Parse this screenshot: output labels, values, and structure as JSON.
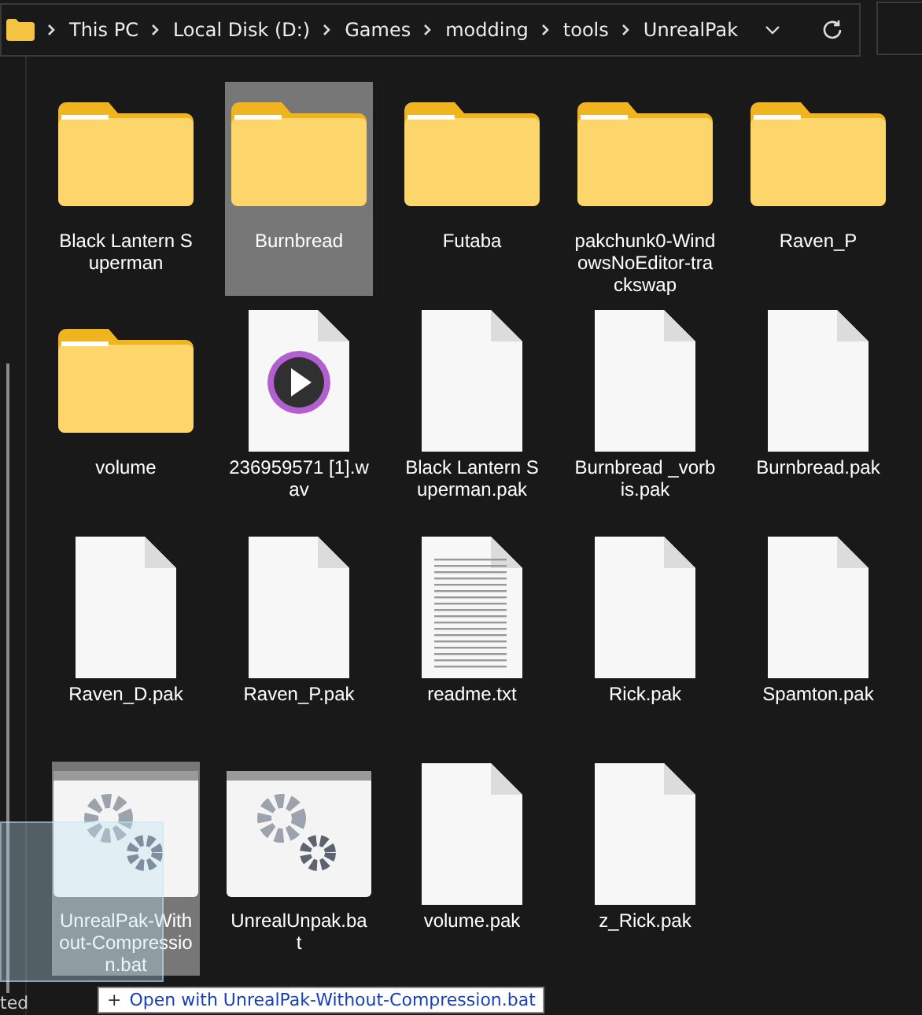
{
  "breadcrumb": [
    "This PC",
    "Local Disk (D:)",
    "Games",
    "modding",
    "tools",
    "UnrealPak"
  ],
  "items": [
    {
      "name": "Black Lantern Superman",
      "kind": "folder",
      "selected": false
    },
    {
      "name": "Burnbread",
      "kind": "folder",
      "selected": true
    },
    {
      "name": "Futaba",
      "kind": "folder",
      "selected": false
    },
    {
      "name": "pakchunk0-WindowsNoEditor-trackswap",
      "kind": "folder",
      "selected": false
    },
    {
      "name": "Raven_P",
      "kind": "folder",
      "selected": false
    },
    {
      "name": "volume",
      "kind": "folder",
      "selected": false
    },
    {
      "name": "236959571 [1].wav",
      "kind": "audio",
      "selected": false
    },
    {
      "name": "Black Lantern Superman.pak",
      "kind": "file",
      "selected": false
    },
    {
      "name": "Burnbread _vorbis.pak",
      "kind": "file",
      "selected": false
    },
    {
      "name": "Burnbread.pak",
      "kind": "file",
      "selected": false
    },
    {
      "name": "Raven_D.pak",
      "kind": "file",
      "selected": false
    },
    {
      "name": "Raven_P.pak",
      "kind": "file",
      "selected": false
    },
    {
      "name": "readme.txt",
      "kind": "text",
      "selected": false
    },
    {
      "name": "Rick.pak",
      "kind": "file",
      "selected": false
    },
    {
      "name": "Spamton.pak",
      "kind": "file",
      "selected": false
    },
    {
      "name": "UnrealPak-Without-Compression.bat",
      "kind": "batch",
      "selected": true
    },
    {
      "name": "UnrealUnpak.bat",
      "kind": "batch",
      "selected": false
    },
    {
      "name": "volume.pak",
      "kind": "file",
      "selected": false
    },
    {
      "name": "z_Rick.pak",
      "kind": "file",
      "selected": false
    }
  ],
  "drag_tooltip": {
    "icon": "+",
    "text": "Open with UnrealPak-Without-Compression.bat"
  },
  "status_bar": {
    "text": "ted"
  }
}
